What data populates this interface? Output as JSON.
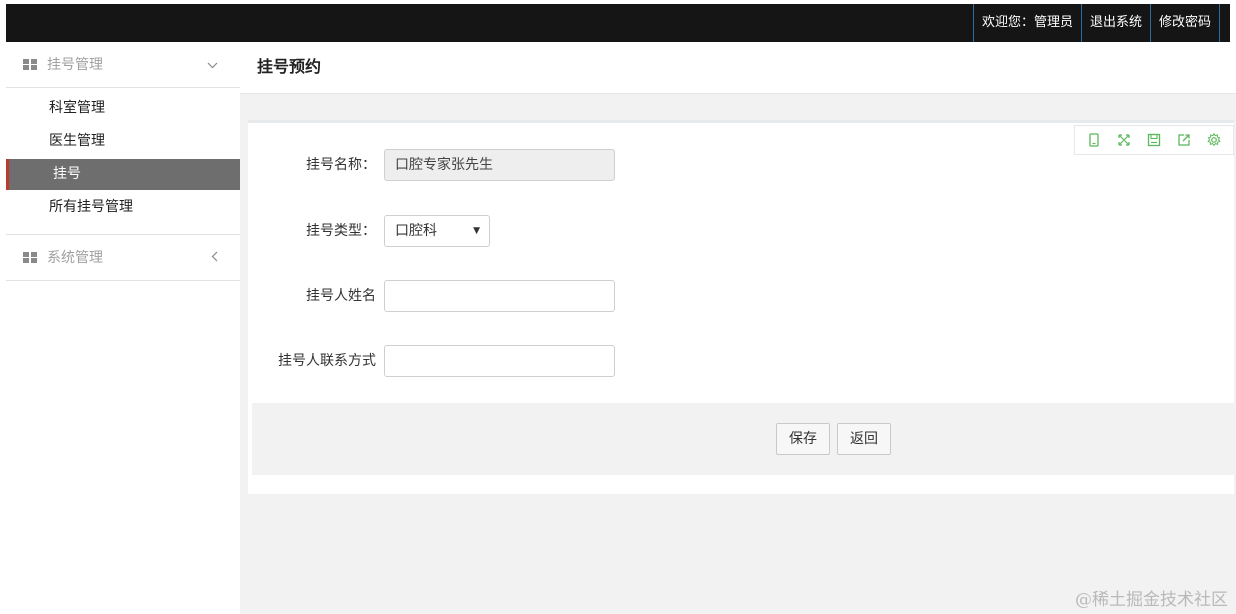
{
  "topbar": {
    "welcome": "欢迎您：管理员",
    "logout": "退出系统",
    "change_password": "修改密码"
  },
  "sidebar": {
    "groups": [
      {
        "label": "挂号管理",
        "icon": "grid-icon",
        "chevron": "chevron-down-icon",
        "items": [
          {
            "label": "科室管理"
          },
          {
            "label": "医生管理"
          },
          {
            "label": "挂号",
            "active": true
          },
          {
            "label": "所有挂号管理"
          }
        ]
      },
      {
        "label": "系统管理",
        "icon": "grid-icon",
        "chevron": "chevron-left-icon"
      }
    ]
  },
  "page": {
    "title": "挂号预约"
  },
  "toolbar": {
    "icons": [
      "mobile-icon",
      "fullscreen-icon",
      "save-icon",
      "export-icon",
      "settings-icon"
    ],
    "color": "#5cb85c"
  },
  "form": {
    "name_label": "挂号名称：",
    "name_value": "口腔专家张先生",
    "type_label": "挂号类型：",
    "type_value": "口腔科",
    "patient_label": "挂号人姓名",
    "patient_value": "",
    "contact_label": "挂号人联系方式",
    "contact_value": ""
  },
  "buttons": {
    "save": "保存",
    "back": "返回"
  },
  "watermark": "@稀土掘金技术社区"
}
